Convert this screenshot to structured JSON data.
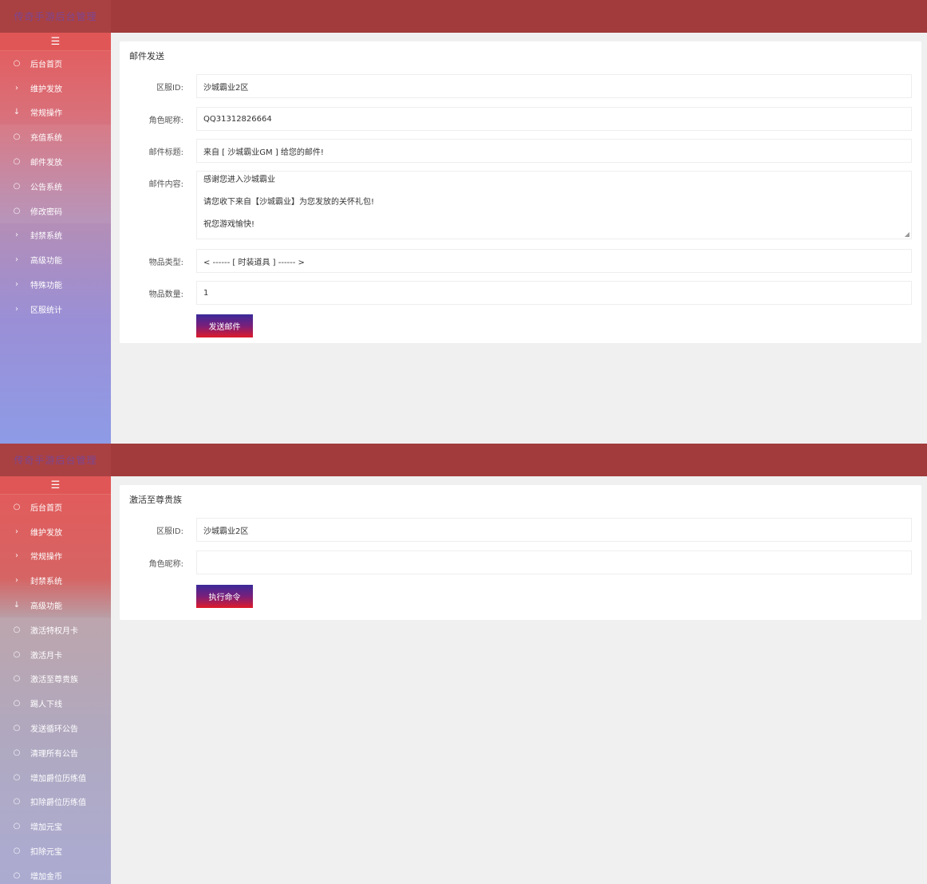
{
  "panel1": {
    "brand": "传奇手游后台管理",
    "toggle_icon": "☰",
    "menu": [
      {
        "label": "后台首页",
        "icon": "○"
      },
      {
        "label": "维护发放",
        "icon": "›"
      },
      {
        "label": "常规操作",
        "icon": "↓"
      },
      {
        "label": "充值系统",
        "icon": "○"
      },
      {
        "label": "邮件发放",
        "icon": "○"
      },
      {
        "label": "公告系统",
        "icon": "○"
      },
      {
        "label": "修改密码",
        "icon": "○"
      },
      {
        "label": "封禁系统",
        "icon": "›"
      },
      {
        "label": "高级功能",
        "icon": "›"
      },
      {
        "label": "特殊功能",
        "icon": "›"
      },
      {
        "label": "区服统计",
        "icon": "›"
      }
    ],
    "form": {
      "title": "邮件发送",
      "server_label": "区服ID:",
      "server_value": "沙城霸业2区",
      "role_label": "角色昵称:",
      "role_value": "QQ31312826664",
      "subject_label": "邮件标题:",
      "subject_value": "来自 [ 沙城霸业GM ] 给您的邮件!",
      "content_label": "邮件内容:",
      "content_lines": [
        "感谢您进入沙城霸业",
        "请您收下来自【沙城霸业】为您发放的关怀礼包!",
        "祝您游戏愉快!"
      ],
      "item_type_label": "物品类型:",
      "item_type_value": "< ------ [ 时装道具 ] ------ >",
      "item_qty_label": "物品数量:",
      "item_qty_value": "1",
      "submit_label": "发送邮件"
    }
  },
  "panel2": {
    "brand": "传奇手游后台管理",
    "toggle_icon": "☰",
    "menu": [
      {
        "label": "后台首页",
        "icon": "○"
      },
      {
        "label": "维护发放",
        "icon": "›"
      },
      {
        "label": "常规操作",
        "icon": "›"
      },
      {
        "label": "封禁系统",
        "icon": "›"
      },
      {
        "label": "高级功能",
        "icon": "↓"
      },
      {
        "label": "激活特权月卡",
        "icon": "○"
      },
      {
        "label": "激活月卡",
        "icon": "○"
      },
      {
        "label": "激活至尊贵族",
        "icon": "○"
      },
      {
        "label": "踢人下线",
        "icon": "○"
      },
      {
        "label": "发送循环公告",
        "icon": "○"
      },
      {
        "label": "清理所有公告",
        "icon": "○"
      },
      {
        "label": "增加爵位历练值",
        "icon": "○"
      },
      {
        "label": "扣除爵位历练值",
        "icon": "○"
      },
      {
        "label": "增加元宝",
        "icon": "○"
      },
      {
        "label": "扣除元宝",
        "icon": "○"
      },
      {
        "label": "增加金币",
        "icon": "○"
      }
    ],
    "form": {
      "title": "激活至尊贵族",
      "server_label": "区服ID:",
      "server_value": "沙城霸业2区",
      "role_label": "角色昵称:",
      "role_value": "",
      "submit_label": "执行命令"
    }
  },
  "colors": {
    "topbar": "#a23b3b",
    "accent_red": "#e45a5a",
    "button_top": "#3a2a9a",
    "button_bottom": "#e01a2a"
  }
}
